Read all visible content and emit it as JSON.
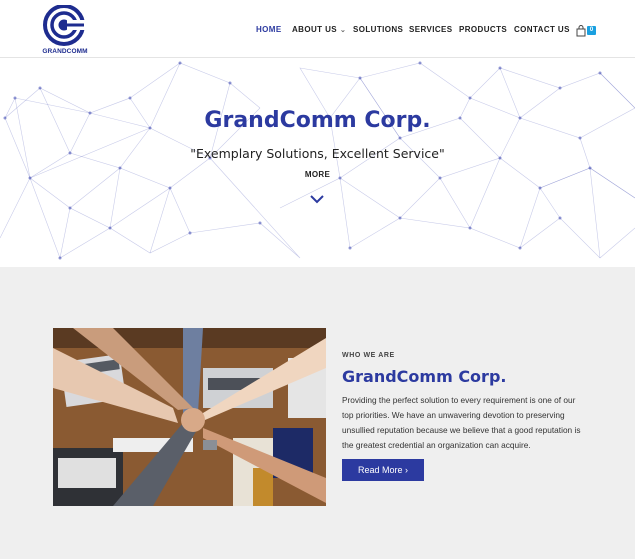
{
  "brand": {
    "logo_text": "GRANDCOMM",
    "color": "#2c3aa0"
  },
  "nav": {
    "items": [
      {
        "label": "HOME",
        "active": true
      },
      {
        "label": "ABOUT US",
        "dropdown": true
      },
      {
        "label": "SOLUTIONS"
      },
      {
        "label": "SERVICES"
      },
      {
        "label": "PRODUCTS"
      },
      {
        "label": "CONTACT US"
      }
    ],
    "caret": "⌄",
    "cart_count": "0",
    "cart_icon": "bag-icon"
  },
  "hero": {
    "title": "GrandComm Corp.",
    "subtitle": "\"Exemplary Solutions, Excellent Service\"",
    "more_label": "MORE",
    "scroll_icon": "chevron-down-icon"
  },
  "about": {
    "eyebrow": "WHO WE ARE",
    "title": "GrandComm Corp.",
    "text": "Providing the perfect solution to every requirement is one of our top priorities. We have an unwavering devotion to preserving unsullied reputation because we believe that a good reputation is the greatest credential an organization can acquire.",
    "button_label": "Read More ›"
  }
}
